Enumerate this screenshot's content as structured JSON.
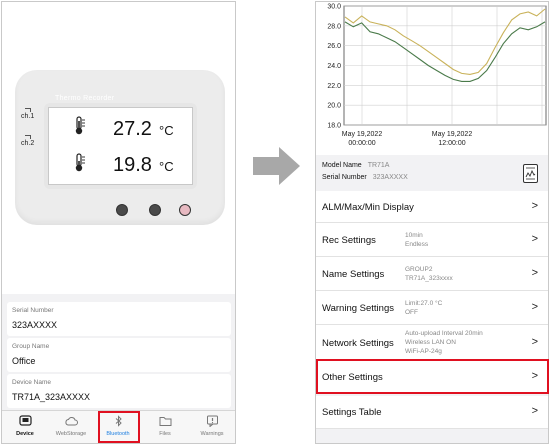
{
  "left": {
    "device": {
      "brand": "Thermo Recorder",
      "ch1_label": "ch.1",
      "ch2_label": "ch.2",
      "ch1_value": "27.2",
      "ch2_value": "19.8",
      "unit": "°C"
    },
    "info": [
      {
        "label": "Serial Number",
        "value": "323AXXXX"
      },
      {
        "label": "Group Name",
        "value": "Office"
      },
      {
        "label": "Device Name",
        "value": "TR71A_323AXXXX"
      }
    ],
    "tabs": [
      {
        "label": "Device",
        "icon": "device-icon"
      },
      {
        "label": "WebStorage",
        "icon": "cloud-icon"
      },
      {
        "label": "Bluetooth",
        "icon": "bluetooth-icon"
      },
      {
        "label": "Files",
        "icon": "folder-icon"
      },
      {
        "label": "Warnings",
        "icon": "warning-icon"
      }
    ]
  },
  "right": {
    "chart_data": {
      "type": "line",
      "y_ticks": [
        "30.0",
        "28.0",
        "26.0",
        "24.0",
        "22.0",
        "20.0",
        "18.0"
      ],
      "ylim": [
        18,
        30
      ],
      "x_ticks": [
        {
          "date": "May 19,2022",
          "time": "00:00:00"
        },
        {
          "date": "May 19,2022",
          "time": "12:00:00"
        }
      ],
      "series": [
        {
          "color": "#c9b25a",
          "values": [
            28.9,
            28.3,
            29.0,
            28.4,
            28.2,
            28.0,
            27.6,
            27.0,
            26.5,
            26.0,
            25.4,
            24.8,
            24.2,
            23.6,
            23.2,
            23.1,
            23.3,
            24.2,
            25.8,
            27.3,
            28.6,
            29.2,
            29.4,
            29.0,
            29.7
          ]
        },
        {
          "color": "#4a7a4a",
          "values": [
            28.4,
            27.9,
            28.3,
            27.4,
            27.2,
            26.8,
            26.4,
            25.8,
            25.2,
            24.6,
            24.0,
            23.5,
            23.0,
            22.6,
            22.4,
            22.4,
            22.7,
            23.5,
            24.8,
            26.2,
            27.2,
            27.8,
            27.6,
            27.9,
            28.4
          ]
        }
      ]
    },
    "model": {
      "model_label": "Model Name",
      "model_value": "TR71A",
      "serial_label": "Serial Number",
      "serial_value": "323AXXXX"
    },
    "menu": [
      {
        "title": "ALM/Max/Min Display",
        "detail": []
      },
      {
        "title": "Rec Settings",
        "detail": [
          "10min",
          "Endless"
        ]
      },
      {
        "title": "Name Settings",
        "detail": [
          "GROUP2",
          "TR71A_323xxxx"
        ]
      },
      {
        "title": "Warning Settings",
        "detail": [
          "Limit:27.0 °C",
          "OFF"
        ]
      },
      {
        "title": "Network Settings",
        "detail": [
          "Auto-upload Interval 20min",
          "Wireless LAN ON",
          "WiFi-AP-24g"
        ]
      },
      {
        "title": "Other Settings",
        "detail": []
      },
      {
        "title": "Settings Table",
        "detail": []
      }
    ],
    "chevron": ">"
  },
  "colors": {
    "highlight": "#e01020",
    "bluetooth_active": "#1e7fe0"
  }
}
